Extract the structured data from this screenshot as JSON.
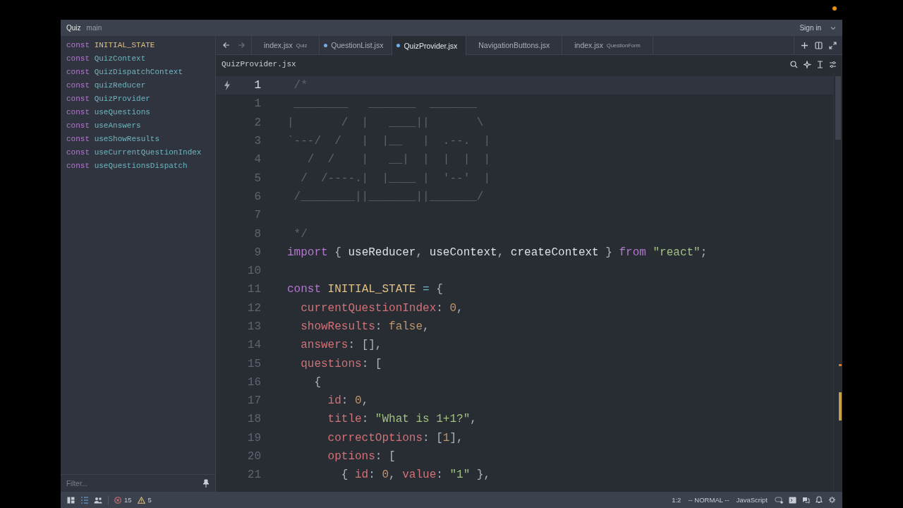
{
  "title_bar": {
    "project": "Quiz",
    "branch": "main",
    "sign_in": "Sign in"
  },
  "outline": {
    "items": [
      {
        "keyword": "const",
        "name": "INITIAL_STATE",
        "kind": "constant"
      },
      {
        "keyword": "const",
        "name": "QuizContext",
        "kind": "variable"
      },
      {
        "keyword": "const",
        "name": "QuizDispatchContext",
        "kind": "variable"
      },
      {
        "keyword": "const",
        "name": "quizReducer",
        "kind": "variable"
      },
      {
        "keyword": "const",
        "name": "QuizProvider",
        "kind": "variable"
      },
      {
        "keyword": "const",
        "name": "useQuestions",
        "kind": "variable"
      },
      {
        "keyword": "const",
        "name": "useAnswers",
        "kind": "variable"
      },
      {
        "keyword": "const",
        "name": "useShowResults",
        "kind": "variable"
      },
      {
        "keyword": "const",
        "name": "useCurrentQuestionIndex",
        "kind": "variable"
      },
      {
        "keyword": "const",
        "name": "useQuestionsDispatch",
        "kind": "variable"
      }
    ],
    "filter": {
      "placeholder": "Filter..."
    }
  },
  "tabs": [
    {
      "label": "index.jsx",
      "detail": "Quiz",
      "modified": false,
      "selected": false
    },
    {
      "label": "QuestionList.jsx",
      "modified": true,
      "selected": false
    },
    {
      "label": "QuizProvider.jsx",
      "modified": true,
      "selected": true
    },
    {
      "label": "NavigationButtons.jsx",
      "modified": false,
      "selected": false
    },
    {
      "label": "index.jsx",
      "detail": "QuestionForm",
      "modified": false,
      "selected": false
    }
  ],
  "breadcrumb": "QuizProvider.jsx",
  "editor": {
    "lines": [
      {
        "number": "1",
        "current": true,
        "tokens": [
          {
            "kind": "comment",
            "text": " /*"
          }
        ]
      },
      {
        "number": "1",
        "current": false,
        "tokens": [
          {
            "kind": "comment",
            "text": " ________   _______  _______"
          }
        ]
      },
      {
        "number": "2",
        "current": false,
        "tokens": [
          {
            "kind": "comment",
            "text": "|       /  |   ____||       \\"
          }
        ]
      },
      {
        "number": "3",
        "current": false,
        "tokens": [
          {
            "kind": "comment",
            "text": "`---/  /   |  |__   |  .--.  |"
          }
        ]
      },
      {
        "number": "4",
        "current": false,
        "tokens": [
          {
            "kind": "comment",
            "text": "   /  /    |   __|  |  |  |  |"
          }
        ]
      },
      {
        "number": "5",
        "current": false,
        "tokens": [
          {
            "kind": "comment",
            "text": "  /  /----.|  |____ |  '--'  |"
          }
        ]
      },
      {
        "number": "6",
        "current": false,
        "tokens": [
          {
            "kind": "comment",
            "text": " /________||_______||_______/"
          }
        ]
      },
      {
        "number": "7",
        "current": false
      },
      {
        "number": "8",
        "current": false,
        "tokens": [
          {
            "kind": "comment",
            "text": " */"
          }
        ]
      },
      {
        "number": "9",
        "current": false,
        "tokens": [
          {
            "kind": "keyword",
            "text": "import"
          },
          {
            "kind": "punct",
            "text": " { "
          },
          {
            "kind": "plain",
            "text": "useReducer"
          },
          {
            "kind": "punct",
            "text": ", "
          },
          {
            "kind": "plain",
            "text": "useContext"
          },
          {
            "kind": "punct",
            "text": ", "
          },
          {
            "kind": "plain",
            "text": "createContext"
          },
          {
            "kind": "punct",
            "text": " } "
          },
          {
            "kind": "keyword",
            "text": "from"
          },
          {
            "kind": "string",
            "text": " \"react\""
          },
          {
            "kind": "punct",
            "text": ";"
          }
        ]
      },
      {
        "number": "10",
        "current": false
      },
      {
        "number": "11",
        "current": false,
        "tokens": [
          {
            "kind": "keyword",
            "text": "const"
          },
          {
            "kind": "constant",
            "text": " INITIAL_STATE"
          },
          {
            "kind": "operator",
            "text": " = "
          },
          {
            "kind": "punct",
            "text": "{"
          }
        ]
      },
      {
        "number": "12",
        "current": false,
        "tokens": [
          {
            "kind": "property",
            "text": "  currentQuestionIndex"
          },
          {
            "kind": "punct",
            "text": ": "
          },
          {
            "kind": "number",
            "text": "0"
          },
          {
            "kind": "punct",
            "text": ","
          }
        ]
      },
      {
        "number": "13",
        "current": false,
        "tokens": [
          {
            "kind": "property",
            "text": "  showResults"
          },
          {
            "kind": "punct",
            "text": ": "
          },
          {
            "kind": "number",
            "text": "false"
          },
          {
            "kind": "punct",
            "text": ","
          }
        ]
      },
      {
        "number": "14",
        "current": false,
        "tokens": [
          {
            "kind": "property",
            "text": "  answers"
          },
          {
            "kind": "punct",
            "text": ": [],"
          }
        ]
      },
      {
        "number": "15",
        "current": false,
        "tokens": [
          {
            "kind": "property",
            "text": "  questions"
          },
          {
            "kind": "punct",
            "text": ": ["
          }
        ]
      },
      {
        "number": "16",
        "current": false,
        "tokens": [
          {
            "kind": "punct",
            "text": "    {"
          }
        ]
      },
      {
        "number": "17",
        "current": false,
        "tokens": [
          {
            "kind": "property",
            "text": "      id"
          },
          {
            "kind": "punct",
            "text": ": "
          },
          {
            "kind": "number",
            "text": "0"
          },
          {
            "kind": "punct",
            "text": ","
          }
        ]
      },
      {
        "number": "18",
        "current": false,
        "tokens": [
          {
            "kind": "property",
            "text": "      title"
          },
          {
            "kind": "punct",
            "text": ": "
          },
          {
            "kind": "string",
            "text": "\"What is 1+1?\""
          },
          {
            "kind": "punct",
            "text": ","
          }
        ]
      },
      {
        "number": "19",
        "current": false,
        "tokens": [
          {
            "kind": "property",
            "text": "      correctOptions"
          },
          {
            "kind": "punct",
            "text": ": ["
          },
          {
            "kind": "number",
            "text": "1"
          },
          {
            "kind": "punct",
            "text": "],"
          }
        ]
      },
      {
        "number": "20",
        "current": false,
        "tokens": [
          {
            "kind": "property",
            "text": "      options"
          },
          {
            "kind": "punct",
            "text": ": ["
          }
        ]
      },
      {
        "number": "21",
        "current": false,
        "tokens": [
          {
            "kind": "punct",
            "text": "        { "
          },
          {
            "kind": "property",
            "text": "id"
          },
          {
            "kind": "punct",
            "text": ": "
          },
          {
            "kind": "number",
            "text": "0"
          },
          {
            "kind": "punct",
            "text": ", "
          },
          {
            "kind": "property",
            "text": "value"
          },
          {
            "kind": "punct",
            "text": ": "
          },
          {
            "kind": "string",
            "text": "\"1\""
          },
          {
            "kind": "punct",
            "text": " },"
          }
        ]
      }
    ]
  },
  "status_bar": {
    "errors": "15",
    "warnings": "5",
    "position": "1:2",
    "mode": "-- NORMAL --",
    "language": "JavaScript"
  }
}
